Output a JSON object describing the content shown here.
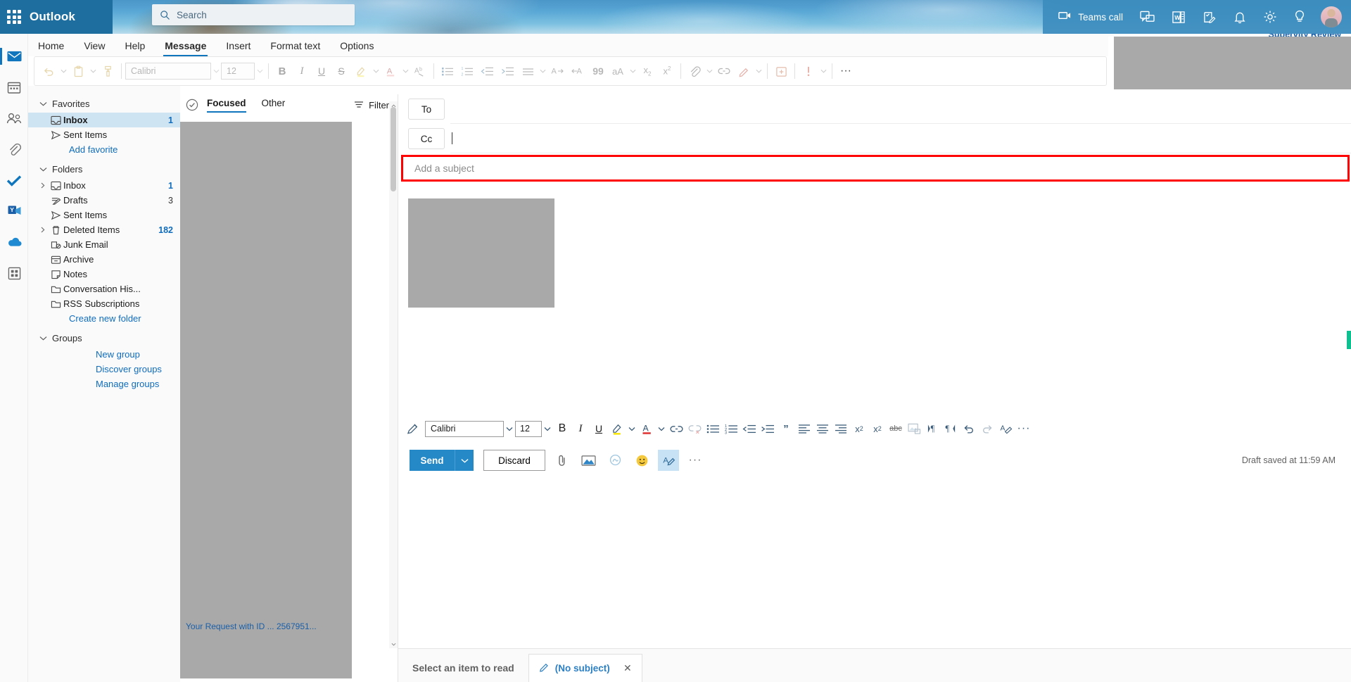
{
  "header": {
    "brand": "Outlook",
    "waffle_icon": "app-launcher-icon",
    "search": {
      "placeholder": "Search",
      "value": "",
      "icon": "search-icon"
    },
    "teams_call": {
      "label": "Teams call",
      "icon": "video-camera-icon"
    },
    "icons": [
      {
        "name": "chat-icon",
        "title": "Chat"
      },
      {
        "name": "office-app-icon",
        "title": "Office"
      },
      {
        "name": "tasks-icon",
        "title": "Tasks"
      },
      {
        "name": "bell-icon",
        "title": "Notifications"
      },
      {
        "name": "gear-icon",
        "title": "Settings"
      },
      {
        "name": "lightbulb-icon",
        "title": "Tips"
      }
    ],
    "avatar": {
      "name": "user-avatar"
    }
  },
  "ribbon": {
    "tabs": [
      {
        "label": "Home",
        "active": false
      },
      {
        "label": "View",
        "active": false
      },
      {
        "label": "Help",
        "active": false
      },
      {
        "label": "Message",
        "active": true
      },
      {
        "label": "Insert",
        "active": false
      },
      {
        "label": "Format text",
        "active": false
      },
      {
        "label": "Options",
        "active": false
      }
    ],
    "font_name": "Calibri",
    "font_size": "12",
    "overflow_label": "···"
  },
  "app_rail": [
    {
      "name": "mail-icon",
      "label": "Mail",
      "active": true
    },
    {
      "name": "calendar-icon",
      "label": "Calendar",
      "active": false
    },
    {
      "name": "people-icon",
      "label": "People",
      "active": false
    },
    {
      "name": "attachments-icon",
      "label": "Files",
      "active": false
    },
    {
      "name": "todo-icon",
      "label": "To Do",
      "active": false
    },
    {
      "name": "yammer-icon",
      "label": "Yammer",
      "active": false
    },
    {
      "name": "onedrive-icon",
      "label": "OneDrive",
      "active": false
    },
    {
      "name": "apps-grid-icon",
      "label": "More apps",
      "active": false
    }
  ],
  "folder_pane": {
    "favorites": {
      "title": "Favorites",
      "items": [
        {
          "label": "Inbox",
          "count": "1",
          "icon": "inbox-icon",
          "selected": true,
          "expandable": false
        },
        {
          "label": "Sent Items",
          "count": "",
          "icon": "sent-icon",
          "selected": false,
          "expandable": false
        }
      ],
      "action": "Add favorite"
    },
    "folders": {
      "title": "Folders",
      "items": [
        {
          "label": "Inbox",
          "count": "1",
          "icon": "inbox-icon",
          "expandable": true,
          "accent": true
        },
        {
          "label": "Drafts",
          "count": "3",
          "icon": "drafts-icon",
          "expandable": false,
          "accent": false
        },
        {
          "label": "Sent Items",
          "count": "",
          "icon": "sent-icon",
          "expandable": false,
          "accent": false
        },
        {
          "label": "Deleted Items",
          "count": "182",
          "icon": "trash-icon",
          "expandable": true,
          "accent": true
        },
        {
          "label": "Junk Email",
          "count": "",
          "icon": "junk-icon",
          "expandable": false,
          "accent": false
        },
        {
          "label": "Archive",
          "count": "",
          "icon": "archive-icon",
          "expandable": false,
          "accent": false
        },
        {
          "label": "Notes",
          "count": "",
          "icon": "notes-icon",
          "expandable": false,
          "accent": false
        },
        {
          "label": "Conversation His...",
          "count": "",
          "icon": "folder-icon",
          "expandable": false,
          "accent": false
        },
        {
          "label": "RSS Subscriptions",
          "count": "",
          "icon": "folder-icon",
          "expandable": false,
          "accent": false
        }
      ],
      "action": "Create new folder"
    },
    "groups": {
      "title": "Groups",
      "links": [
        "New group",
        "Discover groups",
        "Manage groups"
      ]
    }
  },
  "message_list": {
    "select_all_icon": "check-circle-icon",
    "pivots": [
      {
        "label": "Focused",
        "active": true
      },
      {
        "label": "Other",
        "active": false
      }
    ],
    "filter": {
      "label": "Filter",
      "icon": "filter-icon"
    },
    "partial_row_text": "Your Request with ID ... 2567951..."
  },
  "compose": {
    "to": {
      "label": "To",
      "value": ""
    },
    "cc": {
      "label": "Cc",
      "value": ""
    },
    "subject": {
      "placeholder": "Add a subject",
      "value": "",
      "highlight_color": "#ff0000"
    },
    "format_bar": {
      "format_painter_icon": "format-painter-icon",
      "font_name": "Calibri",
      "font_size": "12",
      "bold": "B",
      "italic": "I",
      "underline": "U",
      "quote_glyph": "”",
      "superscript": "x",
      "superscript_sup": "2",
      "subscript": "x",
      "subscript_sub": "2",
      "strikethrough": "abc",
      "more": "···"
    },
    "send": {
      "label": "Send"
    },
    "discard": {
      "label": "Discard"
    },
    "attach_icons": [
      {
        "name": "paperclip-icon",
        "active": false
      },
      {
        "name": "insert-picture-icon",
        "active": false
      },
      {
        "name": "signature-icon",
        "active": false
      },
      {
        "name": "emoji-icon",
        "active": false
      },
      {
        "name": "dictate-icon",
        "active": true
      }
    ],
    "more_options": "···",
    "draft_status": "Draft saved at 11:59 AM"
  },
  "bottom_bar": {
    "reading_pane_note": "Select an item to read",
    "draft_tab": {
      "label": "(No subject)",
      "icon": "pencil-icon",
      "close": "✕"
    }
  },
  "overlay": {
    "supervity_label": "Supervity Review"
  },
  "colors": {
    "accent": "#0f76bd",
    "send_button": "#2589c8",
    "link": "#0f6cbd",
    "highlight": "#ff0000",
    "redaction": "#a9a9a9",
    "selection": "#cfe4f3"
  }
}
